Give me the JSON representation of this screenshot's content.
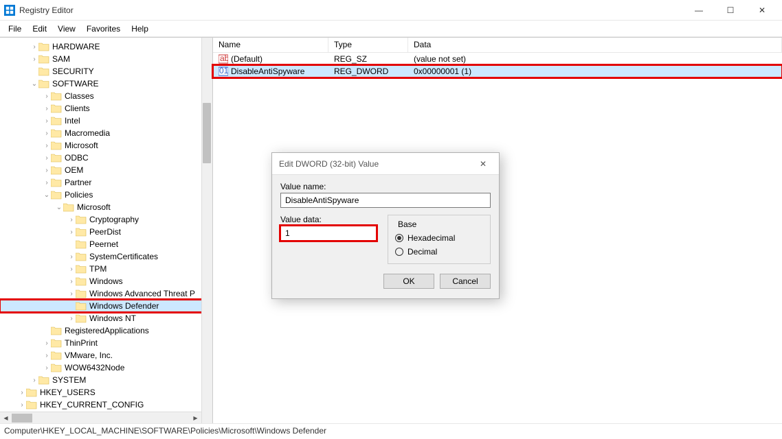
{
  "title": "Registry Editor",
  "menu": {
    "file": "File",
    "edit": "Edit",
    "view": "View",
    "favorites": "Favorites",
    "help": "Help"
  },
  "tree": [
    {
      "label": "HARDWARE",
      "indent": 44,
      "exp": ">"
    },
    {
      "label": "SAM",
      "indent": 44,
      "exp": ">"
    },
    {
      "label": "SECURITY",
      "indent": 44,
      "exp": ""
    },
    {
      "label": "SOFTWARE",
      "indent": 44,
      "exp": "v"
    },
    {
      "label": "Classes",
      "indent": 62,
      "exp": ">"
    },
    {
      "label": "Clients",
      "indent": 62,
      "exp": ">"
    },
    {
      "label": "Intel",
      "indent": 62,
      "exp": ">"
    },
    {
      "label": "Macromedia",
      "indent": 62,
      "exp": ">"
    },
    {
      "label": "Microsoft",
      "indent": 62,
      "exp": ">"
    },
    {
      "label": "ODBC",
      "indent": 62,
      "exp": ">"
    },
    {
      "label": "OEM",
      "indent": 62,
      "exp": ">"
    },
    {
      "label": "Partner",
      "indent": 62,
      "exp": ">"
    },
    {
      "label": "Policies",
      "indent": 62,
      "exp": "v"
    },
    {
      "label": "Microsoft",
      "indent": 80,
      "exp": "v"
    },
    {
      "label": "Cryptography",
      "indent": 98,
      "exp": ">"
    },
    {
      "label": "PeerDist",
      "indent": 98,
      "exp": ">"
    },
    {
      "label": "Peernet",
      "indent": 98,
      "exp": ""
    },
    {
      "label": "SystemCertificates",
      "indent": 98,
      "exp": ">"
    },
    {
      "label": "TPM",
      "indent": 98,
      "exp": ">"
    },
    {
      "label": "Windows",
      "indent": 98,
      "exp": ">"
    },
    {
      "label": "Windows Advanced Threat P",
      "indent": 98,
      "exp": ">"
    },
    {
      "label": "Windows Defender",
      "indent": 98,
      "exp": "",
      "selected": true,
      "red": true
    },
    {
      "label": "Windows NT",
      "indent": 98,
      "exp": ">"
    },
    {
      "label": "RegisteredApplications",
      "indent": 62,
      "exp": ""
    },
    {
      "label": "ThinPrint",
      "indent": 62,
      "exp": ">"
    },
    {
      "label": "VMware, Inc.",
      "indent": 62,
      "exp": ">"
    },
    {
      "label": "WOW6432Node",
      "indent": 62,
      "exp": ">"
    },
    {
      "label": "SYSTEM",
      "indent": 44,
      "exp": ">"
    },
    {
      "label": "HKEY_USERS",
      "indent": 26,
      "exp": ">"
    },
    {
      "label": "HKEY_CURRENT_CONFIG",
      "indent": 26,
      "exp": ">"
    }
  ],
  "list": {
    "cols": {
      "name": "Name",
      "type": "Type",
      "data": "Data"
    },
    "rows": [
      {
        "name": "(Default)",
        "type": "REG_SZ",
        "data": "(value not set)",
        "icon": "sz"
      },
      {
        "name": "DisableAntiSpyware",
        "type": "REG_DWORD",
        "data": "0x00000001 (1)",
        "icon": "dw",
        "selected": true,
        "red": true
      }
    ]
  },
  "dialog": {
    "title": "Edit DWORD (32-bit) Value",
    "value_name_label": "Value name:",
    "value_name": "DisableAntiSpyware",
    "value_data_label": "Value data:",
    "value_data": "1",
    "base_label": "Base",
    "hex": "Hexadecimal",
    "dec": "Decimal",
    "ok": "OK",
    "cancel": "Cancel"
  },
  "statusbar": "Computer\\HKEY_LOCAL_MACHINE\\SOFTWARE\\Policies\\Microsoft\\Windows Defender"
}
